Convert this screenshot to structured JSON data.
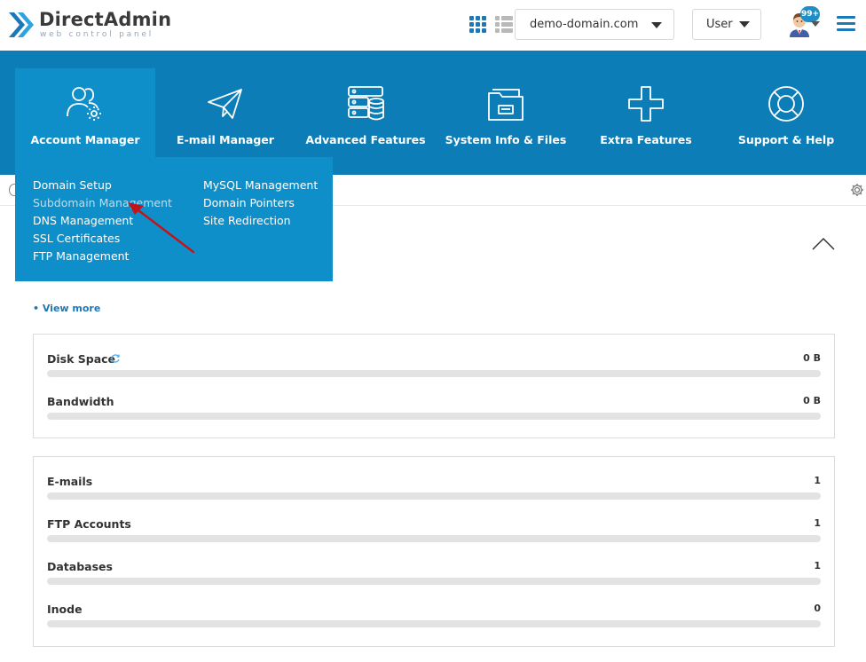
{
  "header": {
    "logo_title": "DirectAdmin",
    "logo_subtitle": "web control panel",
    "domain_select": {
      "value": "demo-domain.com"
    },
    "role_select": {
      "value": "User"
    },
    "notifications_badge": "99+"
  },
  "nav": {
    "items": [
      {
        "label": "Account Manager",
        "icon": "account-users-gear-icon",
        "active": true
      },
      {
        "label": "E-mail Manager",
        "icon": "paper-plane-icon"
      },
      {
        "label": "Advanced Features",
        "icon": "server-database-icon"
      },
      {
        "label": "System Info & Files",
        "icon": "folder-icon"
      },
      {
        "label": "Extra Features",
        "icon": "plus-icon"
      },
      {
        "label": "Support & Help",
        "icon": "lifebuoy-icon"
      }
    ]
  },
  "dropdown": {
    "col1": [
      "Domain Setup",
      "Subdomain Management",
      "DNS Management",
      "SSL Certificates",
      "FTP Management"
    ],
    "col2": [
      "MySQL Management",
      "Domain Pointers",
      "Site Redirection"
    ],
    "hovered": "Subdomain Management"
  },
  "content": {
    "view_more": "• View more",
    "usage_panel": [
      {
        "label": "Disk Space",
        "value": "0 B",
        "fill": 0
      },
      {
        "label": "Bandwidth",
        "value": "0 B",
        "fill": 0
      }
    ],
    "count_panel": [
      {
        "label": "E-mails",
        "value": "1",
        "fill": 0
      },
      {
        "label": "FTP Accounts",
        "value": "1",
        "fill": 0
      },
      {
        "label": "Databases",
        "value": "1",
        "fill": 0
      },
      {
        "label": "Inode",
        "value": "0",
        "fill": 0
      }
    ]
  },
  "colors": {
    "navbar": "#0c7db6",
    "nav_active": "#0f8fc9",
    "accent": "#1d78b8",
    "annotation_arrow": "#c0151b"
  }
}
